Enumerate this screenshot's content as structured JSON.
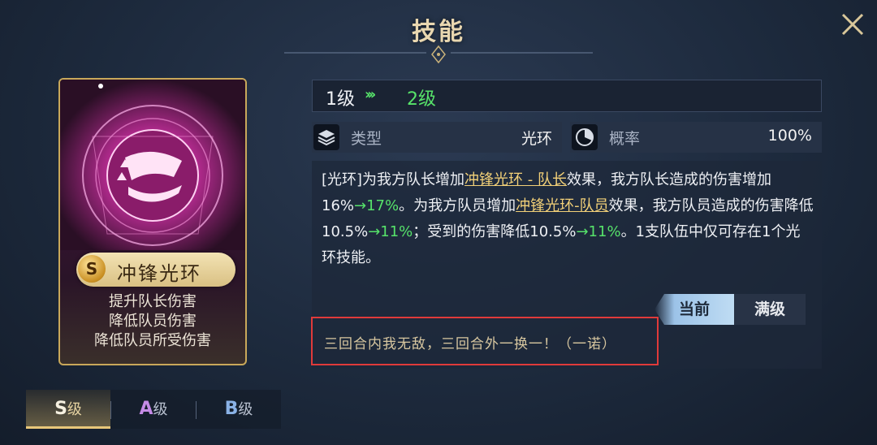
{
  "header": {
    "title": "技能"
  },
  "card": {
    "grade": "S",
    "skill_name": "冲锋光环",
    "effects": [
      "提升队长伤害",
      "降低队员伤害",
      "降低队员所受伤害"
    ]
  },
  "grade_tabs": [
    {
      "letter": "S",
      "suffix": "级",
      "active": true
    },
    {
      "letter": "A",
      "suffix": "级",
      "active": false
    },
    {
      "letter": "B",
      "suffix": "级",
      "active": false
    }
  ],
  "level": {
    "current": "1级",
    "arrow": "›››",
    "next": "2级"
  },
  "stats": {
    "type_label": "类型",
    "type_value": "光环",
    "rate_label": "概率",
    "rate_value": "100%"
  },
  "description": {
    "p1": "[光环]为我方队长增加",
    "link1": "冲锋光环 - 队长",
    "p2": "效果，我方队长造成的伤害增加16%",
    "g1": "→17%",
    "p3": "。为我方队员增加",
    "link2": "冲锋光环-队员",
    "p4": "效果，我方队员造成的伤害降低10.5%",
    "g2": "→11%",
    "p5": "；受到的伤害降低10.5%",
    "g3": "→11%",
    "p6": "。1支队伍中仅可存在1个光环技能。"
  },
  "toggle": {
    "current": "当前",
    "max": "满级"
  },
  "annotation": "三回合内我无敌，三回合外一换一！（一诺）",
  "colors": {
    "gold": "#f2d078",
    "green": "#56e26a",
    "highlight_box": "#e03a3a"
  }
}
